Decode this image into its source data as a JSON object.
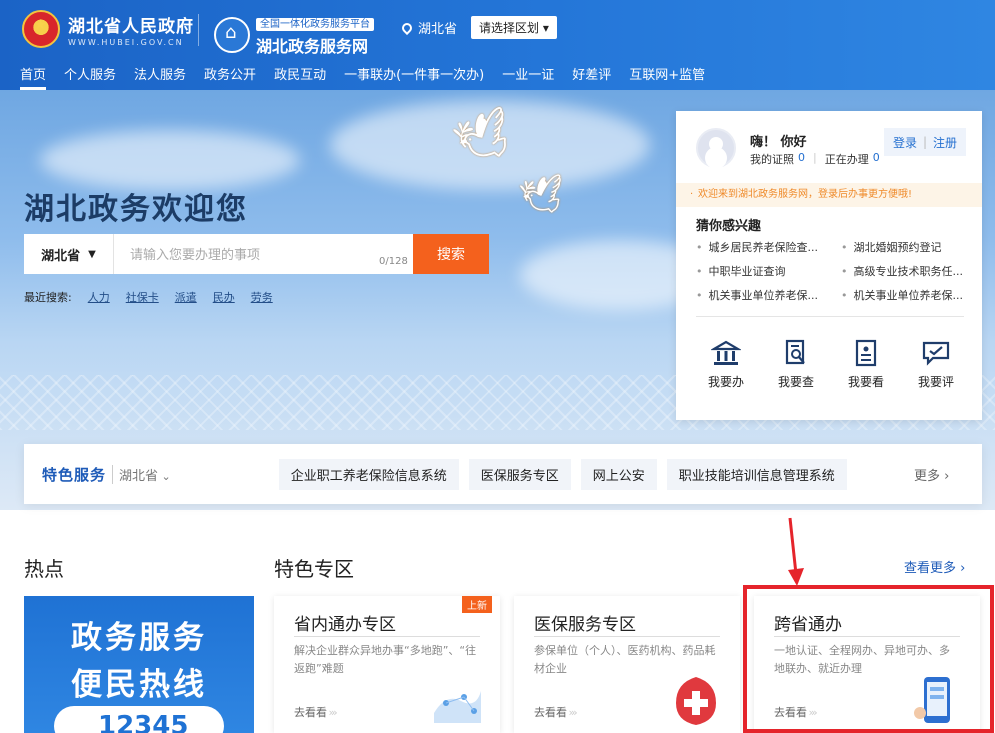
{
  "header": {
    "gov_name": "湖北省人民政府",
    "gov_domain": "WWW.HUBEI.GOV.CN",
    "platform_tag": "全国一体化政务服务平台",
    "platform_name": "湖北政务服务网",
    "location": "湖北省",
    "region_select": "请选择区划 ▾"
  },
  "nav": [
    "首页",
    "个人服务",
    "法人服务",
    "政务公开",
    "政民互动",
    "一事联办(一件事一次办)",
    "一业一证",
    "好差评",
    "互联网+监管"
  ],
  "banner": {
    "welcome": "湖北政务欢迎您",
    "search": {
      "scope": "湖北省",
      "placeholder": "请输入您要办理的事项",
      "counter": "0/128",
      "button": "搜索"
    },
    "recent_label": "最近搜索:",
    "recent": [
      "人力",
      "社保卡",
      "派遣",
      "民办",
      "劳务"
    ]
  },
  "user_card": {
    "greeting": "嗨！ 你好",
    "license_label": "我的证照",
    "license_count": "0",
    "processing_label": "正在办理",
    "processing_count": "0",
    "login": "登录",
    "register": "注册",
    "notice": "欢迎来到湖北政务服务网，登录后办事更方便哦!",
    "interest_title": "猜你感兴趣",
    "interests": [
      "城乡居民养老保险查...",
      "湖北婚姻预约登记",
      "中职毕业证查询",
      "高级专业技术职务任...",
      "机关事业单位养老保...",
      "机关事业单位养老保..."
    ],
    "quick": [
      {
        "label": "我要办",
        "icon": "bank-icon"
      },
      {
        "label": "我要查",
        "icon": "search-doc-icon"
      },
      {
        "label": "我要看",
        "icon": "document-icon"
      },
      {
        "label": "我要评",
        "icon": "comment-icon"
      }
    ]
  },
  "feature_bar": {
    "title": "特色服务",
    "region": "湖北省",
    "links": [
      "企业职工养老保险信息系统",
      "医保服务专区",
      "网上公安",
      "职业技能培训信息管理系统"
    ],
    "more": "更多 ›"
  },
  "sections": {
    "hot_title": "热点",
    "zone_title": "特色专区",
    "more": "查看更多 ›",
    "hot_banner": {
      "line1": "政务服务",
      "line2": "便民热线",
      "hotline": "12345"
    }
  },
  "zones": [
    {
      "title": "省内通办专区",
      "desc": "解决企业群众异地办事“多地跑”、“往返跑”难题",
      "go": "去看看",
      "badge": "上新"
    },
    {
      "title": "医保服务专区",
      "desc": "参保单位（个人）、医药机构、药品耗材企业",
      "go": "去看看"
    },
    {
      "title": "跨省通办",
      "desc": "一地认证、全程网办、异地可办、多地联办、就近办理",
      "go": "去看看"
    }
  ],
  "colors": {
    "primary": "#1b63c6",
    "accent": "#f4611d",
    "highlight": "#e5242b"
  }
}
